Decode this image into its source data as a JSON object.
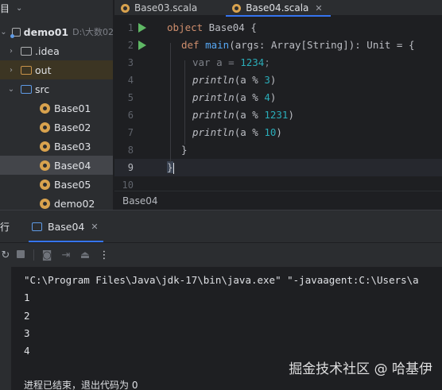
{
  "project": {
    "header_label": "目",
    "items": [
      {
        "label": "demo01",
        "path": "D:\\大数02",
        "type": "module",
        "expanded": true
      },
      {
        "label": ".idea",
        "type": "folder"
      },
      {
        "label": "out",
        "type": "folder"
      },
      {
        "label": "src",
        "type": "source-folder",
        "expanded": true
      },
      {
        "label": "Base01",
        "type": "scala-object"
      },
      {
        "label": "Base02",
        "type": "scala-object"
      },
      {
        "label": "Base03",
        "type": "scala-object"
      },
      {
        "label": "Base04",
        "type": "scala-object",
        "selected": true
      },
      {
        "label": "Base05",
        "type": "scala-object"
      },
      {
        "label": "demo02",
        "type": "scala-object"
      }
    ]
  },
  "tabs": [
    {
      "label": "Base03.scala",
      "active": false
    },
    {
      "label": "Base04.scala",
      "active": true
    }
  ],
  "editor": {
    "line_numbers": [
      "1",
      "2",
      "3",
      "4",
      "5",
      "6",
      "7",
      "8",
      "9",
      "10"
    ],
    "current_line": "9",
    "code": {
      "l1_kw": "object",
      "l1_rest": " Base04 {",
      "l2_kw": "def",
      "l2_fn": "main",
      "l2_rest": "(args: Array[String]): Unit = {",
      "l3_kw": "var",
      "l3_mid": " a = ",
      "l3_num": "1234",
      "l3_end": ";",
      "calls": [
        {
          "fn": "println",
          "arg": "(a % ",
          "num": "3",
          "close": ")"
        },
        {
          "fn": "println",
          "arg": "(a % ",
          "num": "4",
          "close": ")"
        },
        {
          "fn": "println",
          "arg": "(a % ",
          "num": "1231",
          "close": ")"
        },
        {
          "fn": "println",
          "arg": "(a % ",
          "num": "10",
          "close": ")"
        }
      ],
      "l8": "}",
      "l9": "}"
    }
  },
  "breadcrumb": "Base04",
  "run_panel": {
    "title": "行",
    "tab_label": "Base04",
    "command": "\"C:\\Program Files\\Java\\jdk-17\\bin\\java.exe\" \"-javaagent:C:\\Users\\a",
    "output": [
      "1",
      "2",
      "3",
      "4"
    ],
    "status": "进程已结束，退出代码为 0"
  },
  "watermark": "掘金技术社区 @ 哈基伊",
  "colors": {
    "background": "#1e1f22",
    "panel": "#2b2d30",
    "accent": "#3574f0",
    "keyword": "#cf8e6d",
    "function": "#56a8f5",
    "number": "#2aacb8",
    "run_icon": "#5fb865",
    "scala_icon": "#d8a24e"
  }
}
